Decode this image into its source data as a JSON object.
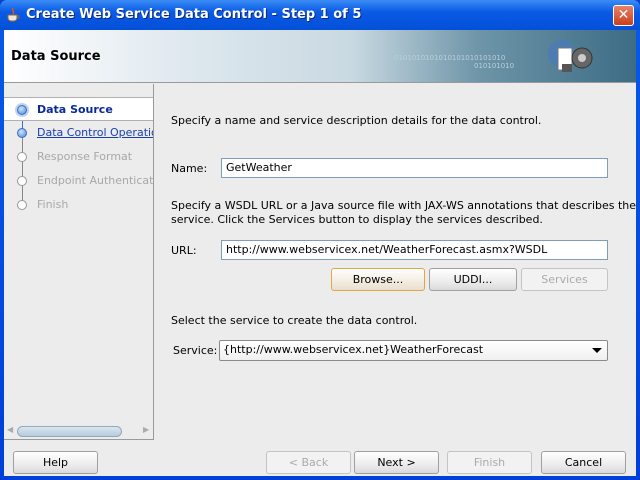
{
  "window": {
    "title": "Create Web Service Data Control - Step 1 of 5"
  },
  "header": {
    "title": "Data Source",
    "binary_text": "0101010101010101010101010",
    "binary_text2": "010101010"
  },
  "nav": {
    "items": [
      {
        "label": "Data Source",
        "state": "current"
      },
      {
        "label": "Data Control Operations",
        "state": "link"
      },
      {
        "label": "Response Format",
        "state": "disabled"
      },
      {
        "label": "Endpoint Authentication",
        "state": "disabled"
      },
      {
        "label": "Finish",
        "state": "disabled"
      }
    ]
  },
  "main": {
    "intro": "Specify a name and service description details for the data control.",
    "name_label": "Name:",
    "name_value": "GetWeather",
    "wsdl_text_1": "Specify a WSDL URL or a Java source file with JAX-WS annotations that describes the",
    "wsdl_text_2": "service. Click the Services button to display the services described.",
    "url_label": "URL:",
    "url_value": "http://www.webservicex.net/WeatherForecast.asmx?WSDL",
    "browse": "Browse...",
    "uddi": "UDDI...",
    "services": "Services",
    "select_text": "Select the service to create the data control.",
    "service_label": "Service:",
    "service_value": "{http://www.webservicex.net}WeatherForecast"
  },
  "footer": {
    "help": "Help",
    "back": "< Back",
    "next": "Next >",
    "finish": "Finish",
    "cancel": "Cancel"
  },
  "colors": {
    "title_bar": "#0a5ae6",
    "link": "#1a3fb0",
    "current": "#0a2a9a",
    "disabled": "#a8a8a8"
  }
}
